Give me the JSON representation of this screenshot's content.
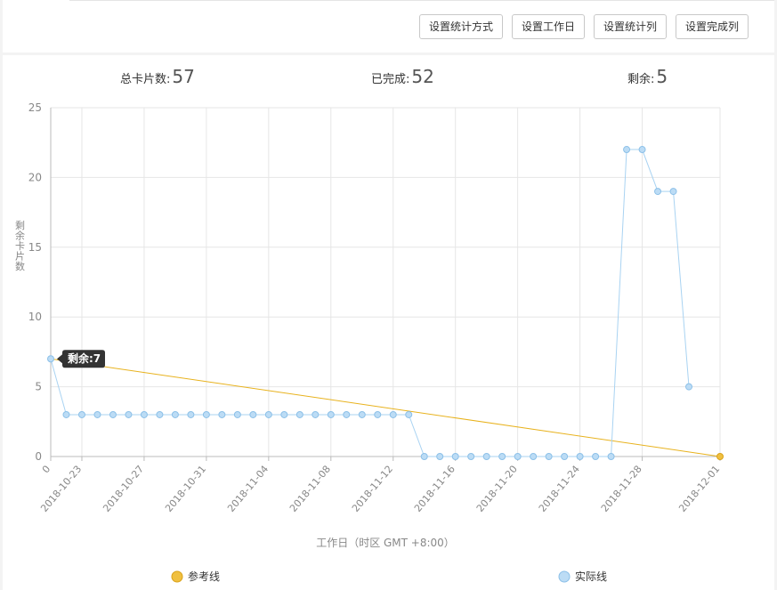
{
  "toolbar": {
    "buttons": [
      "设置统计方式",
      "设置工作日",
      "设置统计列",
      "设置完成列"
    ]
  },
  "stats": {
    "total_label": "总卡片数:",
    "total_value": "57",
    "done_label": "已完成:",
    "done_value": "52",
    "remain_label": "剩余:",
    "remain_value": "5"
  },
  "chart_data": {
    "type": "line",
    "title": "",
    "xlabel": "工作日（时区 GMT +8:00）",
    "ylabel": "剩余卡片数",
    "ylim": [
      0,
      25
    ],
    "yticks": [
      "0",
      "5",
      "10",
      "15",
      "20",
      "25"
    ],
    "xticks": [
      "0",
      "2018-10-23",
      "2018-10-27",
      "2018-10-31",
      "2018-11-04",
      "2018-11-08",
      "2018-11-12",
      "2018-11-16",
      "2018-11-20",
      "2018-11-24",
      "2018-11-28",
      "2018-12-01"
    ],
    "grid": true,
    "legend_position": "bottom",
    "series": [
      {
        "name": "参考线",
        "color": "#e8b21d",
        "points": [
          [
            0,
            7
          ],
          [
            43,
            0
          ]
        ]
      },
      {
        "name": "实际线",
        "color": "#a9d3f2",
        "values": [
          7,
          3,
          3,
          3,
          3,
          3,
          3,
          3,
          3,
          3,
          3,
          3,
          3,
          3,
          3,
          3,
          3,
          3,
          3,
          3,
          3,
          3,
          3,
          3,
          0,
          0,
          0,
          0,
          0,
          0,
          0,
          0,
          0,
          0,
          0,
          0,
          0,
          22,
          22,
          19,
          19,
          5
        ]
      }
    ],
    "tooltip": "剩余:7"
  }
}
